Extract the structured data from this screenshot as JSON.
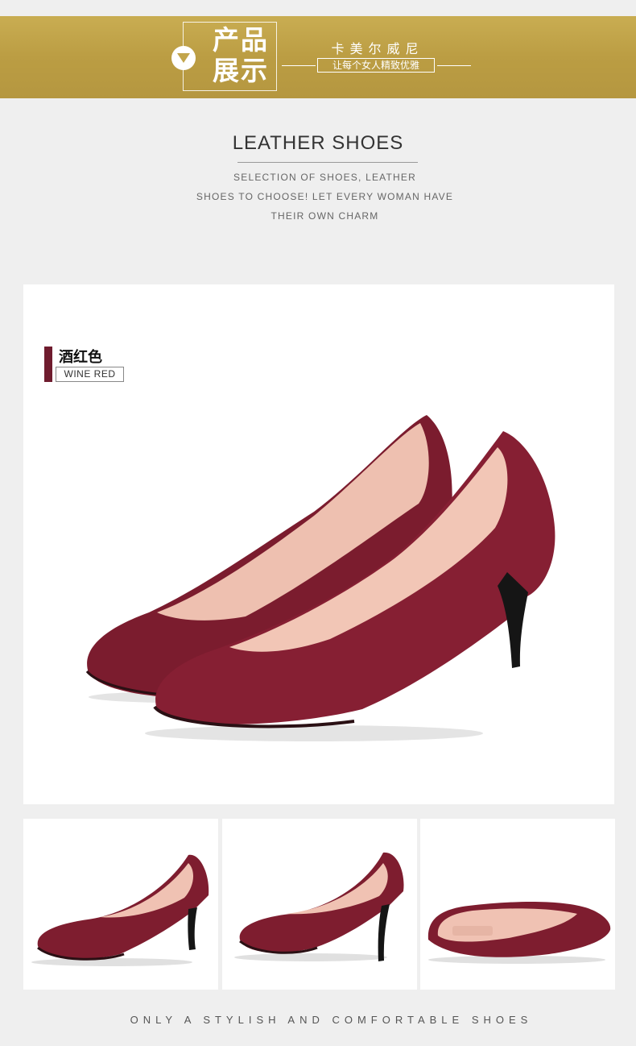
{
  "banner": {
    "title_line1": "产品",
    "title_line2": "展示",
    "brand": "卡美尔威尼",
    "slogan": "让每个女人精致优雅"
  },
  "intro": {
    "heading": "LEATHER SHOES",
    "line1": "SELECTION OF SHOES, LEATHER",
    "line2": "SHOES TO CHOOSE! LET EVERY WOMAN HAVE",
    "line3": "THEIR OWN CHARM"
  },
  "color_tag": {
    "cn": "酒红色",
    "en": "WINE RED"
  },
  "footer": "ONLY A STYLISH AND COMFORTABLE SHOES",
  "colors": {
    "gold": "#c2a54b",
    "wine": "#7a1b2c",
    "lining": "#f0c3b3"
  },
  "icons": [
    "down-triangle-icon"
  ]
}
